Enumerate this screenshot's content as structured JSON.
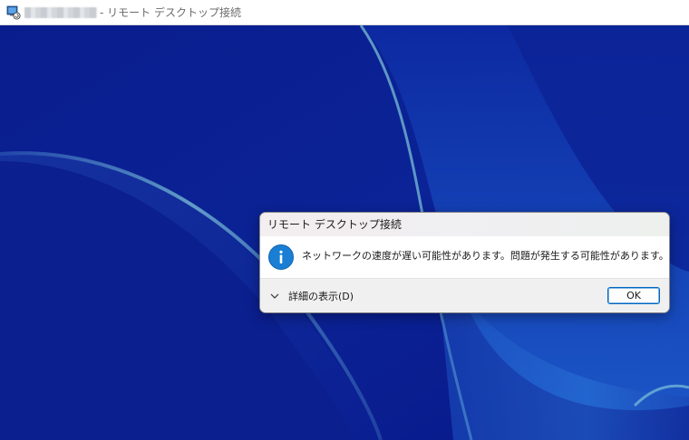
{
  "window": {
    "title_suffix": "- リモート デスクトップ接続"
  },
  "dialog": {
    "title": "リモート デスクトップ接続",
    "icon": "info-icon",
    "message": "ネットワークの速度が遅い可能性があります。問題が発生する可能性があります。",
    "details_label": "詳細の表示(D)",
    "ok_label": "OK"
  },
  "colors": {
    "desktop_base": "#0b1f8f",
    "accent": "#0067c0",
    "info_icon": "#1a7fd4"
  }
}
